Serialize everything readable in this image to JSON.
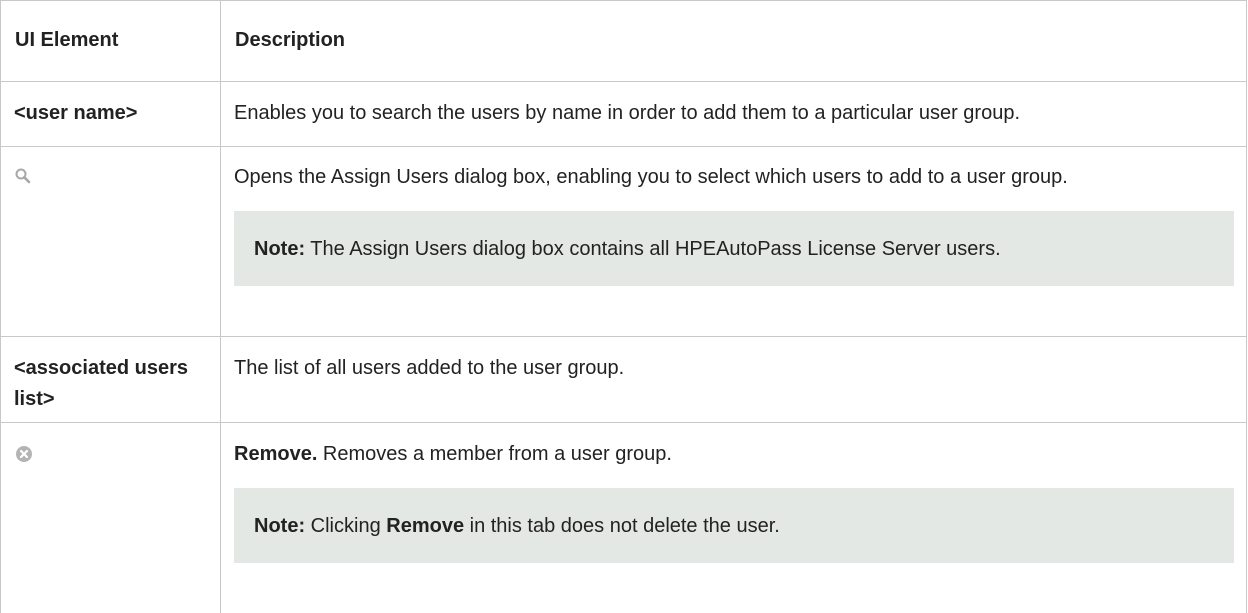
{
  "table": {
    "headers": {
      "element": "UI Element",
      "description": "Description"
    },
    "rows": [
      {
        "element": "<user name>",
        "description": "Enables you to search the users by name in order to add them to a particular user group."
      },
      {
        "icon": "search-icon",
        "description": "Opens the Assign Users dialog box, enabling you to select which users to add to a user group.",
        "note_label": "Note:",
        "note_text": " The Assign Users dialog box contains all HPEAutoPass License Server users."
      },
      {
        "element": "<associated users list>",
        "description": "The list of all users added to the user group."
      },
      {
        "icon": "remove-icon",
        "description_bold": "Remove.",
        "description": " Removes a member from a user group.",
        "note_label": "Note:",
        "note_before": " Clicking ",
        "note_bold": "Remove",
        "note_after": " in this tab does not delete the user."
      }
    ]
  },
  "colors": {
    "border": "#c8c8c8",
    "note_background": "#e4e8e4",
    "icon_gray": "#a8a8a8"
  }
}
